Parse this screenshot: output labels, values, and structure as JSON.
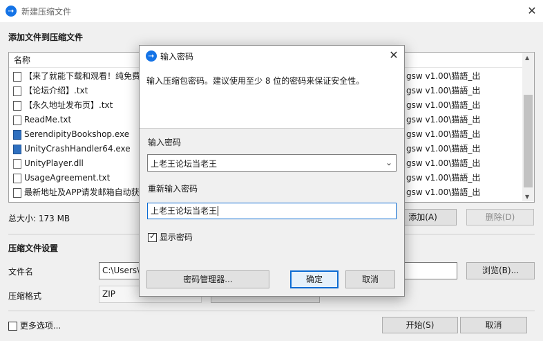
{
  "window": {
    "title": "新建压缩文件",
    "close": "✕"
  },
  "add_section": {
    "heading": "添加文件到压缩文件"
  },
  "file_list": {
    "column_name": "名称",
    "rows": [
      {
        "name": "【来了就能下载和观看！纯免费",
        "type": "txt",
        "path": "gsw v1.00\\猫語_出"
      },
      {
        "name": "【论坛介绍】.txt",
        "type": "txt",
        "path": "gsw v1.00\\猫語_出"
      },
      {
        "name": "【永久地址发布页】.txt",
        "type": "txt",
        "path": "gsw v1.00\\猫語_出"
      },
      {
        "name": "ReadMe.txt",
        "type": "txt",
        "path": "gsw v1.00\\猫語_出"
      },
      {
        "name": "SerendipityBookshop.exe",
        "type": "exe",
        "path": "gsw v1.00\\猫語_出"
      },
      {
        "name": "UnityCrashHandler64.exe",
        "type": "exe",
        "path": "gsw v1.00\\猫語_出"
      },
      {
        "name": "UnityPlayer.dll",
        "type": "dll",
        "path": "gsw v1.00\\猫語_出"
      },
      {
        "name": "UsageAgreement.txt",
        "type": "txt",
        "path": "gsw v1.00\\猫語_出"
      },
      {
        "name": "最新地址及APP请发邮箱自动获",
        "type": "txt",
        "path": "gsw v1.00\\猫語_出"
      }
    ]
  },
  "total_size": "总大小: 173 MB",
  "buttons": {
    "add": "添加(A)",
    "remove": "删除(D)",
    "browse": "浏览(B)...",
    "start": "开始(S)",
    "cancel": "取消"
  },
  "settings": {
    "heading": "压缩文件设置",
    "filename_label": "文件名",
    "filename_value": "C:\\Users\\",
    "format_label": "压缩格式",
    "format_value": "ZIP",
    "more_options": "更多选项..."
  },
  "dialog": {
    "title": "输入密码",
    "close": "✕",
    "description": "输入压缩包密码。建议使用至少 8 位的密码来保证安全性。",
    "password_label": "输入密码",
    "password_value": "上老王论坛当老王",
    "confirm_label": "重新输入密码",
    "confirm_value": "上老王论坛当老王",
    "show_password": "显示密码",
    "manager_button": "密码管理器...",
    "ok_button": "确定",
    "cancel_button": "取消"
  }
}
